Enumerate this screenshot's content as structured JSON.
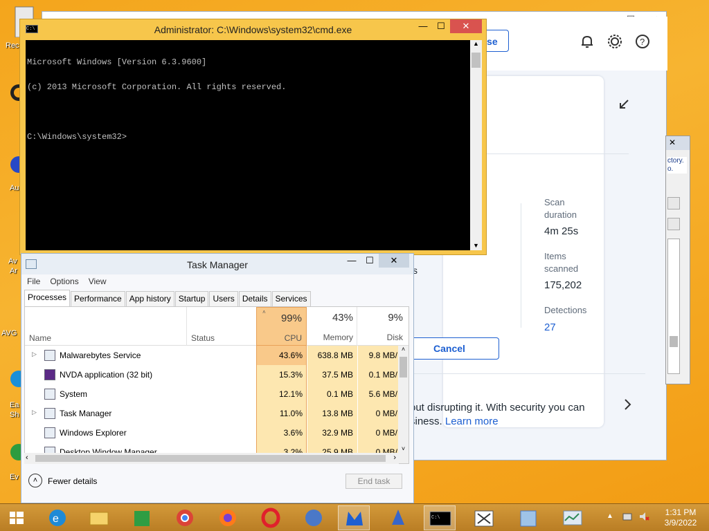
{
  "desktop": {
    "icon_labels": [
      "Rec",
      "Au",
      "Av",
      "Ar",
      "AVG",
      "Ea",
      "Sh",
      "Ev"
    ]
  },
  "malwarebytes": {
    "activate_label": "ate license",
    "stats": [
      {
        "label_line1": "Scan",
        "label_line2": "duration",
        "value": "4m 25s"
      },
      {
        "label_line1": "Items",
        "label_line2": "scanned",
        "value": "175,202"
      },
      {
        "label_line1": "Detections",
        "label_line2": "",
        "value": "27"
      }
    ],
    "cancel_label": "Cancel",
    "promo_line1": "out disrupting it. With security you can",
    "promo_line2": "siness.",
    "learn_more": "Learn more",
    "side_text": "s",
    "side_dialog_text1": "ctory.",
    "side_dialog_text2": "o."
  },
  "cmd": {
    "title": "Administrator: C:\\Windows\\system32\\cmd.exe",
    "line1": "Microsoft Windows [Version 6.3.9600]",
    "line2": "(c) 2013 Microsoft Corporation. All rights reserved.",
    "line3": "C:\\Windows\\system32>"
  },
  "taskmanager": {
    "title": "Task Manager",
    "menu": [
      "File",
      "Options",
      "View"
    ],
    "tabs": [
      "Processes",
      "Performance",
      "App history",
      "Startup",
      "Users",
      "Details",
      "Services"
    ],
    "headers": {
      "name": "Name",
      "status": "Status",
      "cpu_pct": "99%",
      "cpu": "CPU",
      "mem_pct": "43%",
      "mem": "Memory",
      "disk_pct": "9%",
      "disk": "Disk"
    },
    "rows": [
      {
        "name": "Malwarebytes Service",
        "cpu": "43.6%",
        "mem": "638.8 MB",
        "disk": "9.8 MB/"
      },
      {
        "name": "NVDA application (32 bit)",
        "cpu": "15.3%",
        "mem": "37.5 MB",
        "disk": "0.1 MB/"
      },
      {
        "name": "System",
        "cpu": "12.1%",
        "mem": "0.1 MB",
        "disk": "5.6 MB/"
      },
      {
        "name": "Task Manager",
        "cpu": "11.0%",
        "mem": "13.8 MB",
        "disk": "0 MB/"
      },
      {
        "name": "Windows Explorer",
        "cpu": "3.6%",
        "mem": "32.9 MB",
        "disk": "0 MB/"
      },
      {
        "name": "Desktop Window Manager",
        "cpu": "3.2%",
        "mem": "25.9 MB",
        "disk": "0 MB/"
      }
    ],
    "fewer_details": "Fewer details",
    "end_task": "End task"
  },
  "taskbar": {
    "time": "1:31 PM",
    "date": "3/9/2022"
  },
  "colors": {
    "desktop": "#f4a51c",
    "cmd_frame": "#f7c64b",
    "accent_blue": "#1d5fd1",
    "cpu_hot": "#f9c98a",
    "cpu_warm": "#fde7b0"
  }
}
